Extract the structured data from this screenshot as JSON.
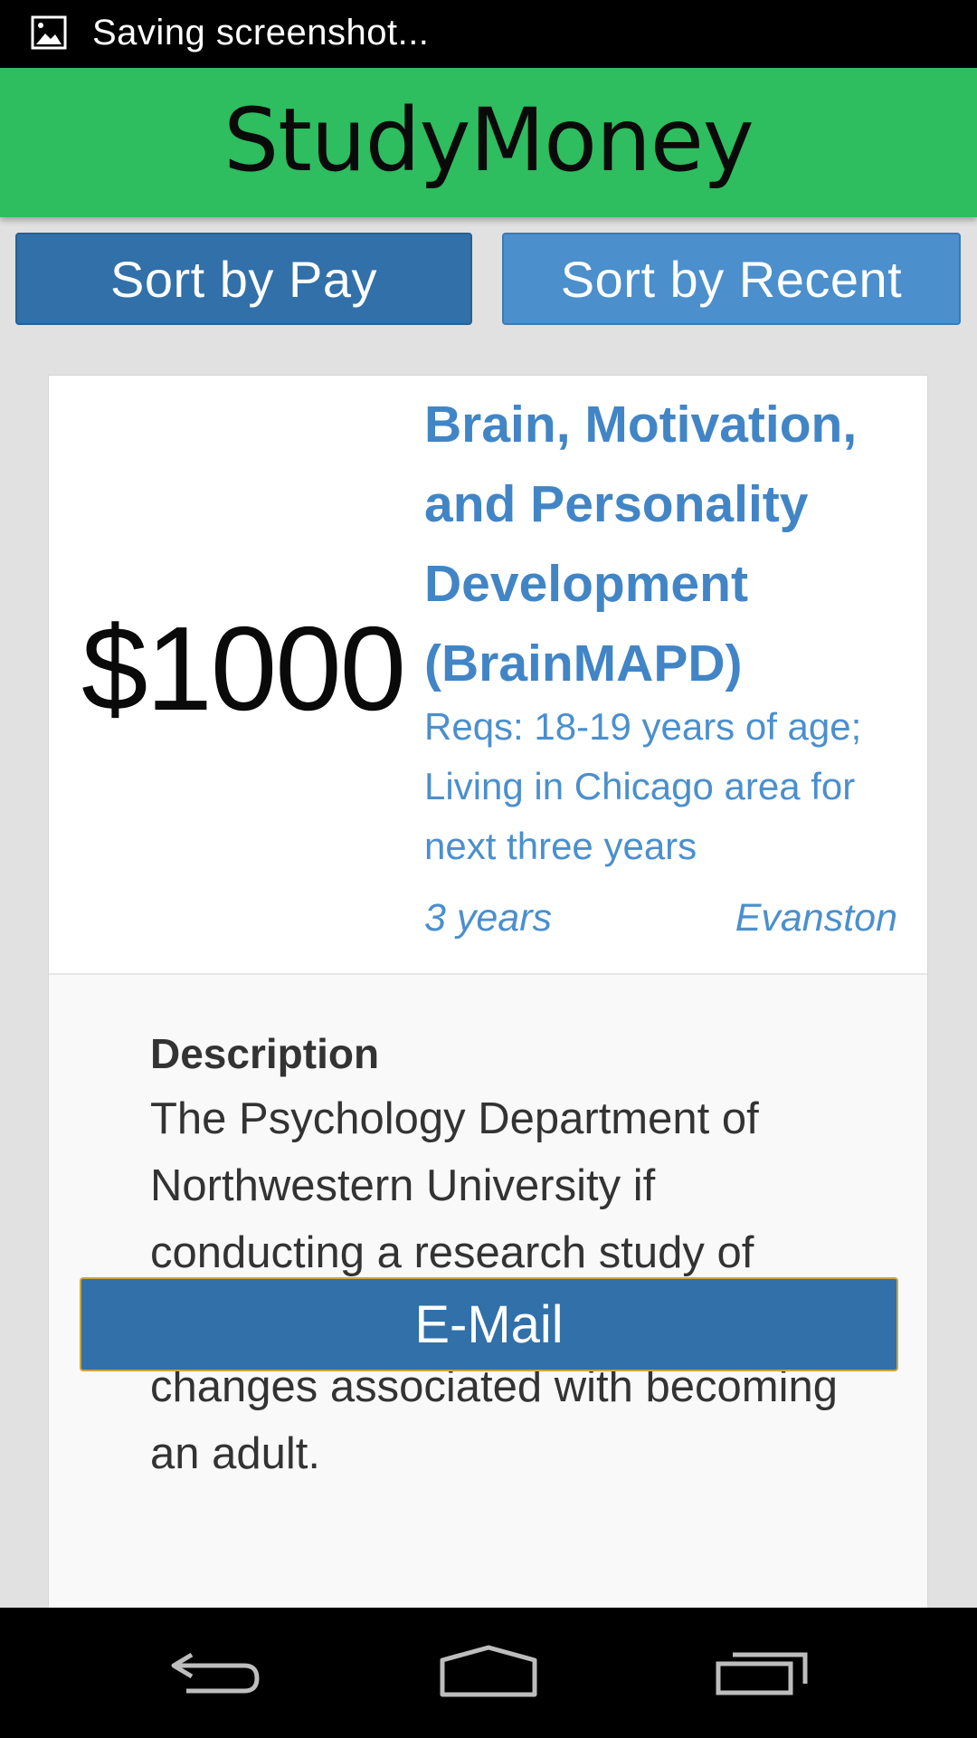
{
  "status_bar": {
    "notification_icon": "image-icon",
    "text": "Saving screenshot..."
  },
  "app": {
    "title": "StudyMoney"
  },
  "sort": {
    "pay_label": "Sort by Pay",
    "recent_label": "Sort by Recent"
  },
  "study": {
    "pay": "$1000",
    "title": "Brain, Motivation, and Personality Development (BrainMAPD)",
    "reqs": "Reqs: 18-19 years of age; Living in Chicago area for next three years",
    "duration": "3 years",
    "location": "Evanston",
    "description_heading": "Description",
    "description": "The Psychology Department of Northwestern University if conducting a research study of psychological and neurological changes associated with becoming an adult.",
    "email_label": "E-Mail"
  },
  "nav": {
    "back_icon": "back-icon",
    "home_icon": "home-icon",
    "recents_icon": "recents-icon"
  },
  "colors": {
    "header_green": "#2ebd5f",
    "button_dark_blue": "#3170a9",
    "button_light_blue": "#4b8fcd",
    "link_blue": "#4185c6"
  }
}
